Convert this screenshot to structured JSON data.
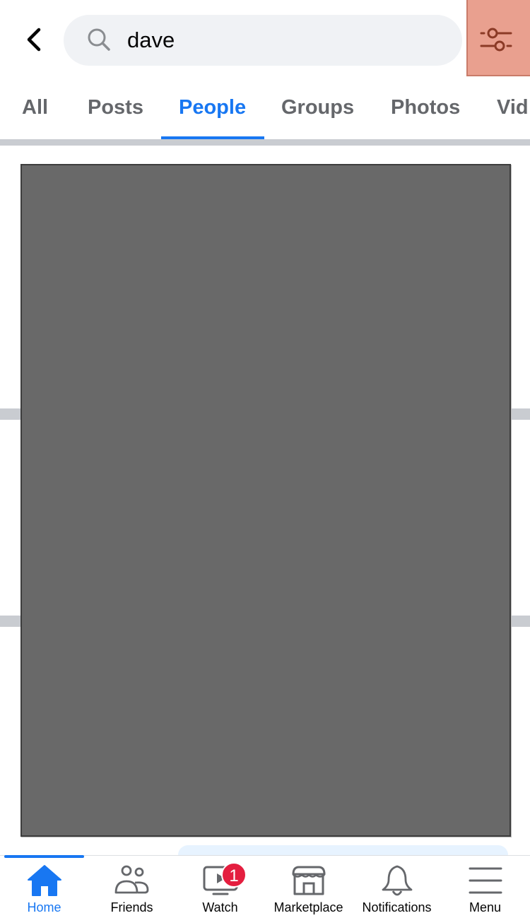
{
  "header": {
    "back_icon": "chevron-left-icon",
    "search_icon": "search-icon",
    "search_value": "dave",
    "filter_icon": "sliders-icon",
    "filter_highlight_color": "#e9a08f"
  },
  "tabs": [
    {
      "label": "All",
      "active": false
    },
    {
      "label": "Posts",
      "active": false
    },
    {
      "label": "People",
      "active": true
    },
    {
      "label": "Groups",
      "active": false
    },
    {
      "label": "Photos",
      "active": false
    },
    {
      "label": "Vid",
      "active": false
    }
  ],
  "content": {
    "redacted_region": true
  },
  "bottom_nav": {
    "items": [
      {
        "label": "Home",
        "icon": "home-icon",
        "active": true
      },
      {
        "label": "Friends",
        "icon": "friends-icon",
        "active": false
      },
      {
        "label": "Watch",
        "icon": "watch-icon",
        "active": false,
        "badge": "1"
      },
      {
        "label": "Marketplace",
        "icon": "marketplace-icon",
        "active": false
      },
      {
        "label": "Notifications",
        "icon": "bell-icon",
        "active": false
      },
      {
        "label": "Menu",
        "icon": "menu-icon",
        "active": false
      }
    ]
  },
  "colors": {
    "accent": "#1877f2",
    "badge": "#e41e3f",
    "tab_inactive": "#65676b",
    "search_bg": "#f0f2f5"
  }
}
